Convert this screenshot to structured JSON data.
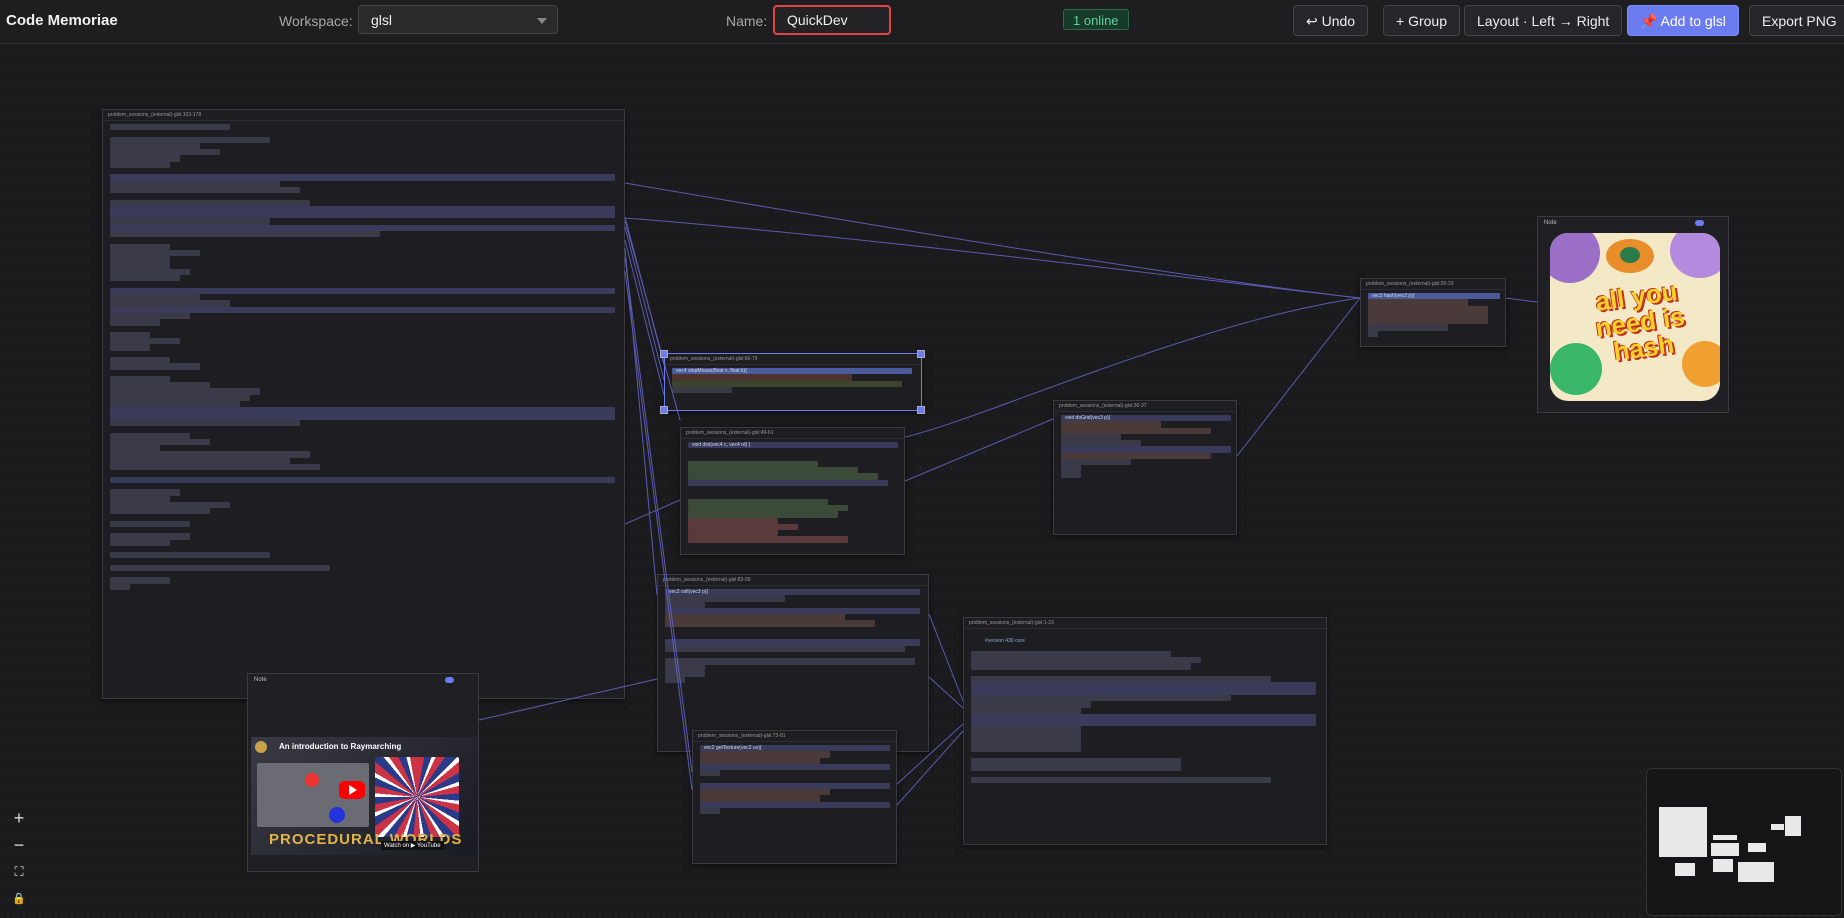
{
  "app": {
    "title": "Code Memoriae"
  },
  "toolbar": {
    "workspace_label": "Workspace:",
    "workspace_value": "glsl",
    "name_label": "Name:",
    "name_value": "QuickDev",
    "online_status": "1 online",
    "undo": "↩ Undo",
    "group": "+ Group",
    "layout": "Layout · Left → Right",
    "add": "📌 Add to glsl",
    "export": "Export PNG"
  },
  "zoom": {
    "in": "+",
    "out": "−",
    "fit": "⛶",
    "lock": "🔒"
  },
  "nodes": {
    "main": {
      "title": "problem_sessions_(external)-glsl:103-178"
    },
    "smooth": {
      "title": "problem_sessions_(external)-glsl:66-79",
      "first_line": "vec4 stepMouse(float x, float k){"
    },
    "dist": {
      "title": "problem_sessions_(external)-glsl:49-61",
      "first_line": "void dist(vec4 c, vec4 rd) {"
    },
    "cell": {
      "title": "problem_sessions_(external)-glsl:83-99",
      "first_line": "vec2 cell(vec3 p){"
    },
    "texture": {
      "title": "problem_sessions_(external)-glsl:73-81",
      "first_line": "vec2 getTexture(vec2 uv){"
    },
    "uniforms": {
      "title": "problem_sessions_(external)-glsl:1-23",
      "first_line": "#version 430 core"
    },
    "grid": {
      "title": "problem_sessions_(external)-glsl:30-37",
      "first_line": "void doGrid(vec3 p){"
    },
    "hash": {
      "title": "problem_sessions_(external)-glsl:20-23",
      "first_line": "vec2 hash(vec2 p){"
    }
  },
  "notes": {
    "video": {
      "title": "Note",
      "video_title": "An introduction to Raymarching",
      "video_overlay": "PROCEDURAL WORLDS",
      "watch": "Watch on ▶ YouTube"
    },
    "image": {
      "title": "Note",
      "poster_text": "all you need is hash"
    }
  }
}
